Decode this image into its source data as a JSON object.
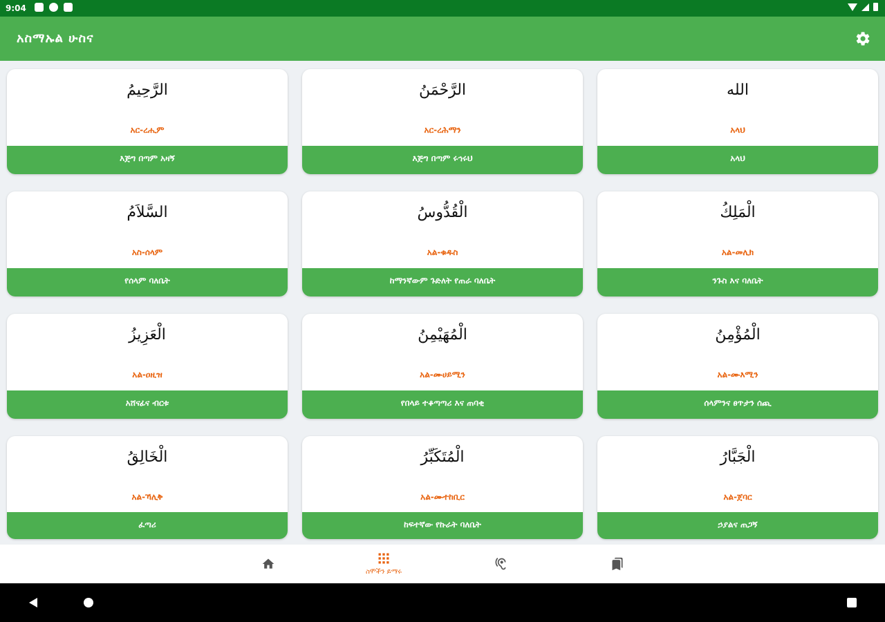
{
  "status_bar": {
    "time": "9:04"
  },
  "app_bar": {
    "title": "አስማኡል ሁስና"
  },
  "cards": [
    {
      "arabic": "الرَّحِيمُ",
      "translit": "አር-ረሒም",
      "meaning": "እጅግ በጣም አዛኝ"
    },
    {
      "arabic": "الرَّحْمَنُ",
      "translit": "አር-ረሕማን",
      "meaning": "እጅግ በጣም ሩኅሩህ"
    },
    {
      "arabic": "الله",
      "translit": "አላህ",
      "meaning": "አላህ"
    },
    {
      "arabic": "السَّلاَمُ",
      "translit": "አስ-ሰላም",
      "meaning": "የሰላም ባለቤት"
    },
    {
      "arabic": "الْقُدُّوسُ",
      "translit": "አል-ቁዱስ",
      "meaning": "ከማንኛውም ጉድለት የጠራ ባለቤት"
    },
    {
      "arabic": "الْمَلِكُ",
      "translit": "አል-መሊክ",
      "meaning": "ንጉስ እና ባለቤት"
    },
    {
      "arabic": "الْعَزِيزُ",
      "translit": "አል-ዐዚዝ",
      "meaning": "አሸናፊና ብርቱ"
    },
    {
      "arabic": "الْمُهَيْمِنُ",
      "translit": "አል-ሙሀይሚን",
      "meaning": "የበላይ ተቆጣጣሪ እና ጠባቂ"
    },
    {
      "arabic": "الْمُؤْمِنُ",
      "translit": "አል-ሙእሚን",
      "meaning": "ሰላምንና ፀጥታን ሰጪ"
    },
    {
      "arabic": "الْخَالِقُ",
      "translit": "አል-ኻሊቅ",
      "meaning": "ፈጣሪ"
    },
    {
      "arabic": "الْمُتَكَبِّرُ",
      "translit": "አል-ሙተከቢር",
      "meaning": "ከፍተኛው የኩራት ባለቤት"
    },
    {
      "arabic": "الْجَبَّارُ",
      "translit": "አል-ጀባር",
      "meaning": "ኃያልና ጠጋኝ"
    }
  ],
  "bottom_nav": {
    "items": [
      {
        "icon": "home-icon"
      },
      {
        "icon": "grid-icon",
        "label": "ስሞችን ይማሩ",
        "active": true
      },
      {
        "icon": "hearing-icon"
      },
      {
        "icon": "bookmarks-icon"
      }
    ]
  },
  "colors": {
    "accent": "#4caf50",
    "status_bar": "#0b7a24",
    "translit": "#e8620d"
  }
}
